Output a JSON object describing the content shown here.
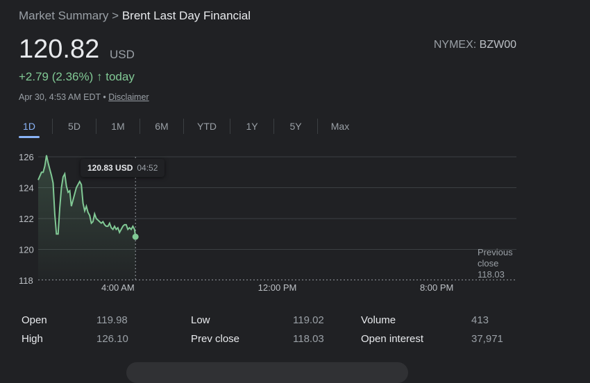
{
  "breadcrumb": {
    "parent": "Market Summary",
    "separator": ">",
    "current": "Brent Last Day Financial"
  },
  "quote": {
    "price": "120.82",
    "currency": "USD",
    "exchange": "NYMEX:",
    "symbol": "BZW00",
    "change": "+2.79 (2.36%)",
    "change_arrow": "↑",
    "change_period": "today",
    "timestamp": "Apr 30, 4:53 AM EDT",
    "timestamp_sep": "•",
    "disclaimer": "Disclaimer",
    "up_color": "#81c995"
  },
  "tabs": [
    {
      "label": "1D",
      "active": true
    },
    {
      "label": "5D",
      "active": false
    },
    {
      "label": "1M",
      "active": false
    },
    {
      "label": "6M",
      "active": false
    },
    {
      "label": "YTD",
      "active": false
    },
    {
      "label": "1Y",
      "active": false
    },
    {
      "label": "5Y",
      "active": false
    },
    {
      "label": "Max",
      "active": false
    }
  ],
  "tooltip": {
    "value": "120.83 USD",
    "time": "04:52"
  },
  "previous_close": {
    "line1": "Previous",
    "line2": "close",
    "value": "118.03"
  },
  "chart_data": {
    "type": "area",
    "y_ticks": [
      "126",
      "124",
      "122",
      "120",
      "118"
    ],
    "x_ticks": [
      "4:00 AM",
      "12:00 PM",
      "8:00 PM"
    ],
    "ylim": [
      118,
      126
    ],
    "x_range": [
      "00:00",
      "24:00"
    ],
    "baseline": 118.03,
    "line_color": "#81c995",
    "series": [
      {
        "x": [
          "00:00",
          "00:10",
          "00:15",
          "00:20",
          "00:25",
          "00:30",
          "00:35",
          "00:40",
          "00:45",
          "00:50",
          "00:55",
          "01:00",
          "01:05",
          "01:10",
          "01:15",
          "01:20",
          "01:25",
          "01:30",
          "01:35",
          "01:40",
          "01:45",
          "01:50",
          "01:55",
          "02:00",
          "02:05",
          "02:10",
          "02:15",
          "02:20",
          "02:25",
          "02:30",
          "02:35",
          "02:40",
          "02:45",
          "02:50",
          "02:55",
          "03:00",
          "03:05",
          "03:10",
          "03:15",
          "03:20",
          "03:25",
          "03:30",
          "03:35",
          "03:40",
          "03:45",
          "03:50",
          "03:55",
          "04:00",
          "04:05",
          "04:10",
          "04:15",
          "04:20",
          "04:25",
          "04:30",
          "04:35",
          "04:40",
          "04:45",
          "04:50",
          "04:53"
        ],
        "y": [
          124.5,
          125.0,
          125.0,
          125.4,
          126.1,
          125.6,
          125.2,
          124.8,
          124.3,
          122.3,
          121.0,
          121.0,
          122.7,
          124.0,
          124.7,
          124.9,
          124.1,
          123.7,
          123.8,
          122.8,
          123.2,
          123.6,
          124.0,
          124.2,
          124.4,
          124.2,
          123.0,
          122.5,
          122.8,
          122.4,
          122.2,
          121.7,
          121.8,
          122.3,
          122.0,
          121.9,
          121.8,
          121.7,
          121.8,
          121.6,
          121.5,
          121.5,
          121.7,
          121.4,
          121.3,
          121.5,
          121.3,
          121.4,
          121.1,
          121.3,
          121.5,
          121.6,
          121.6,
          121.3,
          121.4,
          121.3,
          121.5,
          121.3,
          120.82
        ]
      }
    ]
  },
  "stats": [
    {
      "label": "Open",
      "value": "119.98"
    },
    {
      "label": "High",
      "value": "126.10"
    },
    {
      "label": "Low",
      "value": "119.02"
    },
    {
      "label": "Prev close",
      "value": "118.03"
    },
    {
      "label": "Volume",
      "value": "413"
    },
    {
      "label": "Open interest",
      "value": "37,971"
    }
  ]
}
